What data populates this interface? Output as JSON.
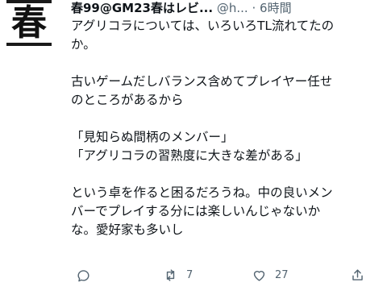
{
  "author": {
    "avatar_char": "春",
    "display_name": "春99@GM23春はレビ...",
    "handle": "@h...",
    "separator": "·",
    "time_ago": "6時間"
  },
  "tweet_lines": [
    "アグリコラについては、いろいろTL流れてたの",
    "か。",
    "",
    "古いゲームだしバランス含めてプレイヤー任せ",
    "のところがあるから",
    "",
    "「見知らぬ間柄のメンバー」",
    "「アグリコラの習熟度に大きな差がある」",
    "",
    "という卓を作ると困るだろうね。中の良いメン",
    "バーでプレイする分には楽しいんじゃないか",
    "な。愛好家も多いし"
  ],
  "actions": {
    "reply_icon": "reply-icon",
    "retweet_icon": "retweet-icon",
    "retweet_count": "7",
    "like_icon": "heart-icon",
    "like_count": "27",
    "share_icon": "share-icon"
  },
  "colors": {
    "text": "#0f1419",
    "muted": "#536471",
    "background": "#ffffff"
  }
}
